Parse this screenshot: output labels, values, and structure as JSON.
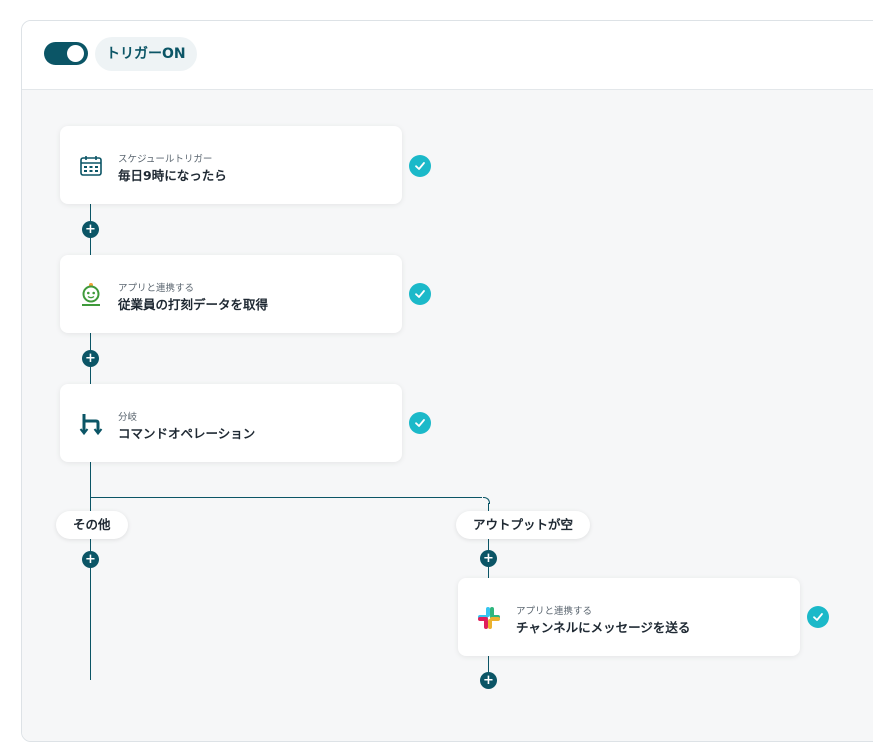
{
  "header": {
    "toggle_state": "on",
    "trigger_label": "トリガーON"
  },
  "steps": [
    {
      "subtitle": "スケジュールトリガー",
      "title": "毎日9時になったら",
      "icon": "calendar-icon",
      "status": "completed"
    },
    {
      "subtitle": "アプリと連携する",
      "title": "従業員の打刻データを取得",
      "icon": "freee-hr-app-icon",
      "status": "completed"
    },
    {
      "subtitle": "分岐",
      "title": "コマンドオペレーション",
      "icon": "branch-icon",
      "status": "completed"
    }
  ],
  "branches": [
    {
      "label": "その他"
    },
    {
      "label": "アウトプットが空",
      "step": {
        "subtitle": "アプリと連携する",
        "title": "チャンネルにメッセージを送る",
        "icon": "slack-icon",
        "status": "completed"
      }
    }
  ],
  "colors": {
    "primary": "#0b5566",
    "check": "#1bb9c9",
    "canvas_bg": "#f6f7f8"
  }
}
